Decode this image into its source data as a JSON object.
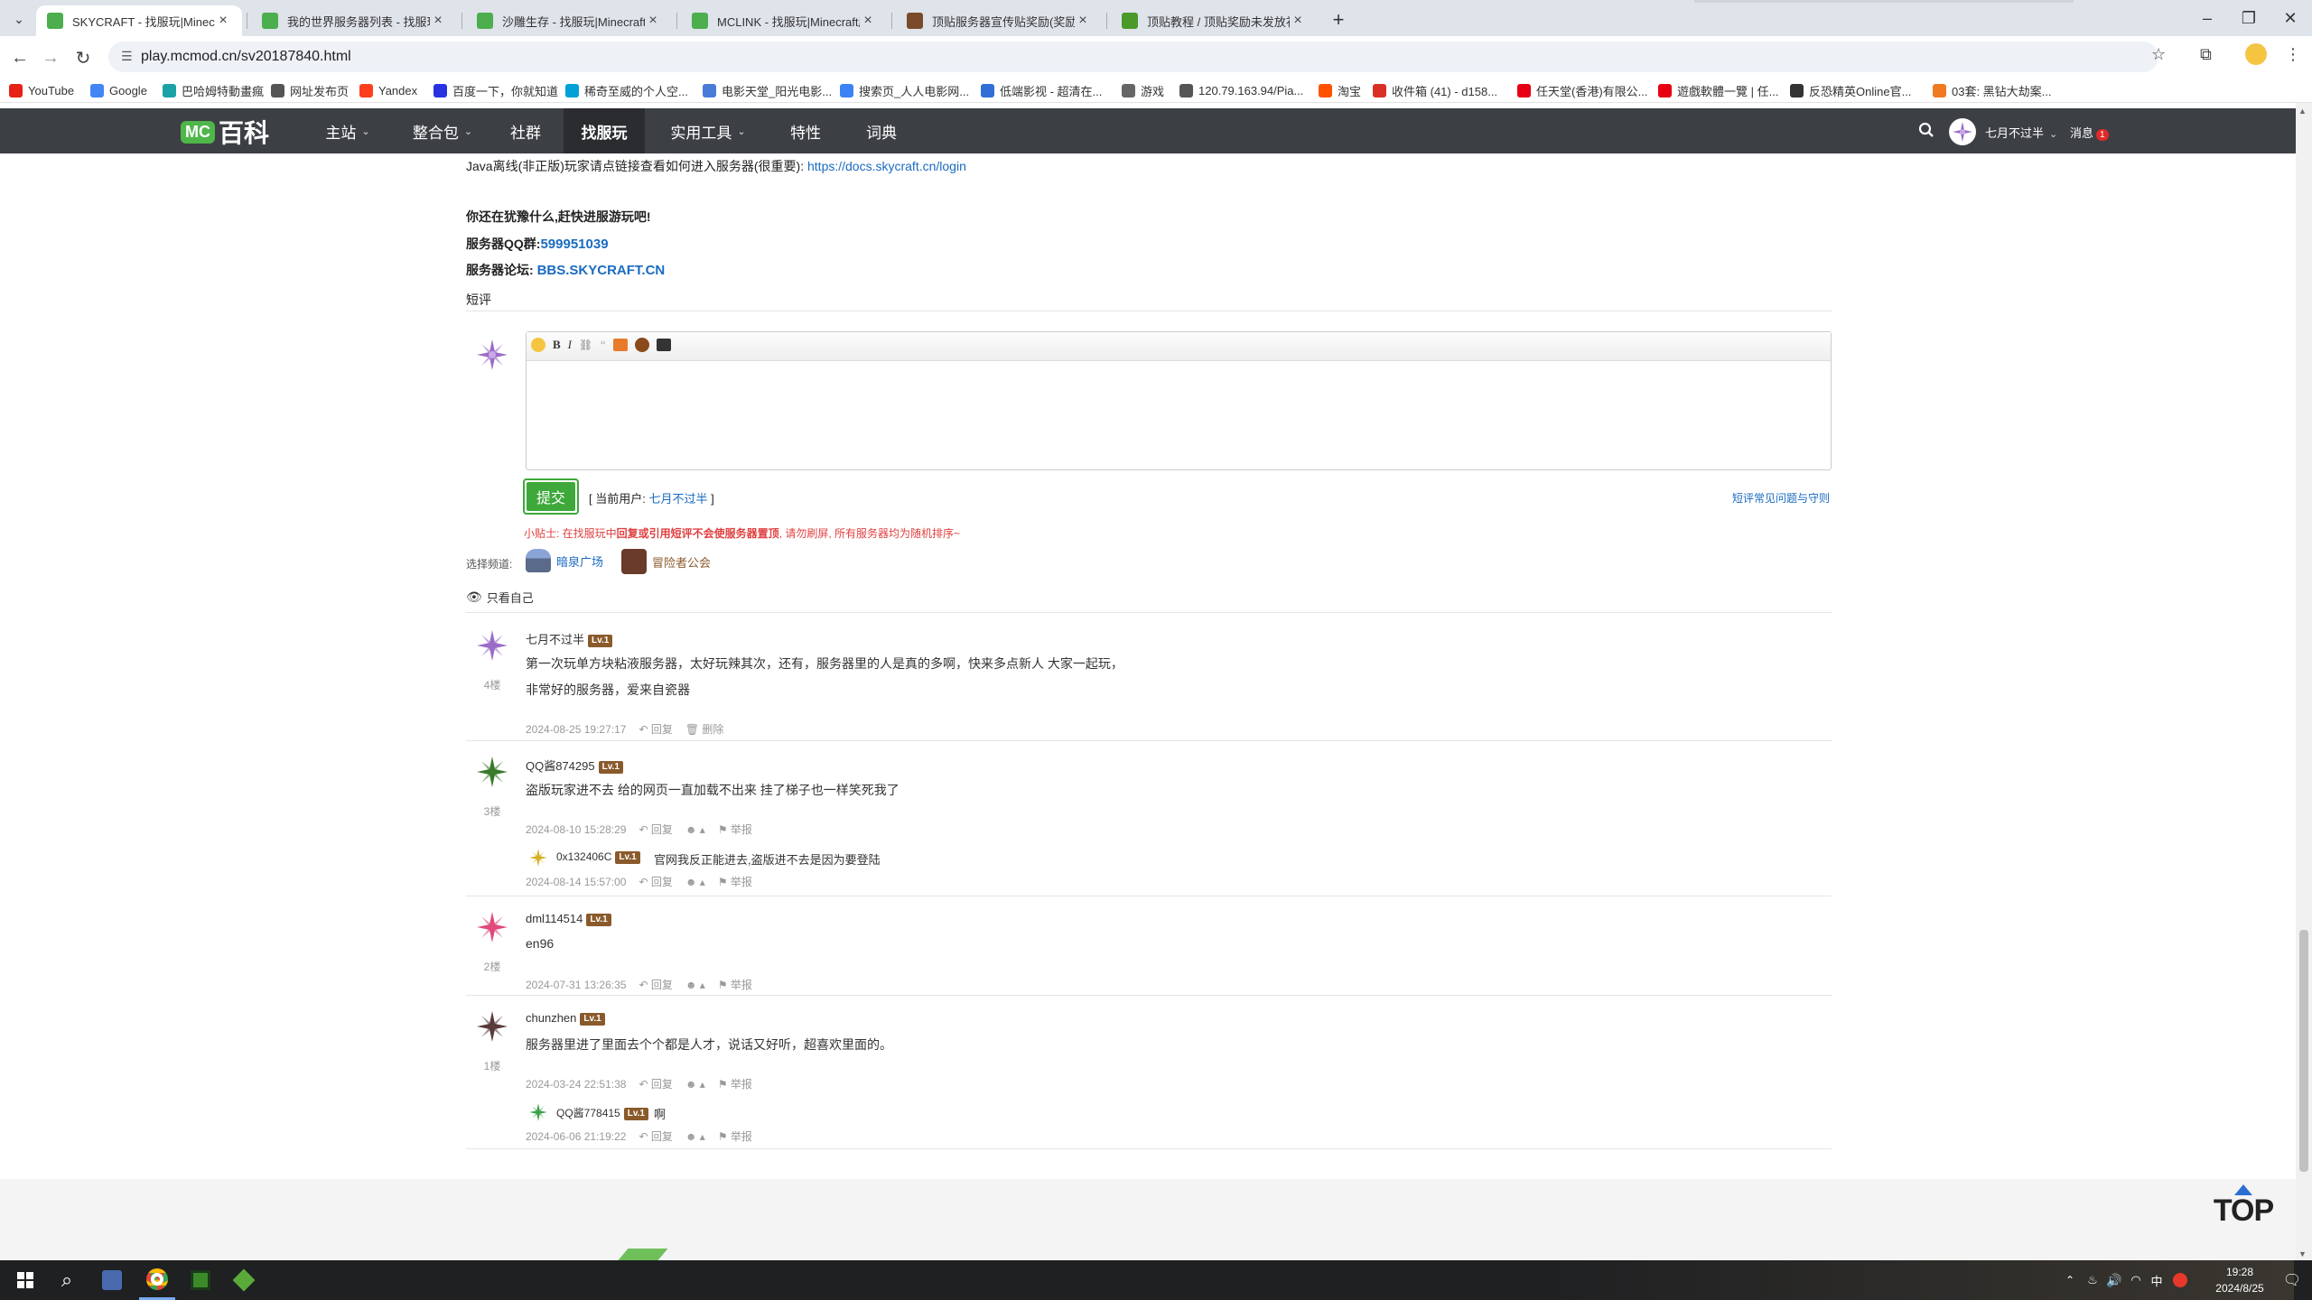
{
  "browser": {
    "tabs": [
      {
        "title": "SKYCRAFT - 找服玩|Minecraft",
        "color": "#4cae4c"
      },
      {
        "title": "我的世界服务器列表 - 找服玩|M",
        "color": "#4cae4c"
      },
      {
        "title": "沙雕生存 - 找服玩|Minecraft服",
        "color": "#4cae4c"
      },
      {
        "title": "MCLINK - 找服玩|Minecraft服",
        "color": "#4cae4c"
      },
      {
        "title": "顶贴服务器宣传贴奖励(奖励天空",
        "color": "#7a4a2a"
      },
      {
        "title": "顶贴教程 / 顶贴奖励未发放补领",
        "color": "#4a9a2a"
      }
    ],
    "new_tab": "+",
    "url": "play.mcmod.cn/sv20187840.html",
    "bookmarks": [
      {
        "label": "YouTube",
        "color": "#e62117"
      },
      {
        "label": "Google",
        "color": "#4285f4"
      },
      {
        "label": "巴哈姆特動畫瘋",
        "color": "#1aa2a6"
      },
      {
        "label": "网址发布页",
        "color": "#555"
      },
      {
        "label": "Yandex",
        "color": "#fc3f1d"
      },
      {
        "label": "百度一下，你就知道",
        "color": "#2932e1"
      },
      {
        "label": "稀奇至威的个人空...",
        "color": "#00a1d6"
      },
      {
        "label": "电影天堂_阳光电影...",
        "color": "#4a7bd8"
      },
      {
        "label": "搜索页_人人电影网...",
        "color": "#3b82f6"
      },
      {
        "label": "低端影视 - 超清在...",
        "color": "#2f6fd6"
      },
      {
        "label": "游戏",
        "color": "#666"
      },
      {
        "label": "120.79.163.94/Pia...",
        "color": "#555"
      },
      {
        "label": "淘宝",
        "color": "#ff5000"
      },
      {
        "label": "收件箱 (41) - d158...",
        "color": "#d93025"
      },
      {
        "label": "任天堂(香港)有限公...",
        "color": "#e60012"
      },
      {
        "label": "遊戲軟體一覽 | 任...",
        "color": "#e60012"
      },
      {
        "label": "反恐精英Online官...",
        "color": "#333"
      },
      {
        "label": "03套: 黑钻大劫案...",
        "color": "#f07a20"
      }
    ]
  },
  "site": {
    "logo_mc": "MC",
    "logo_text": "百科",
    "nav": [
      {
        "label": "主站",
        "caret": true
      },
      {
        "label": "整合包",
        "caret": true
      },
      {
        "label": "社群",
        "caret": false
      },
      {
        "label": "找服玩",
        "caret": false,
        "selected": true
      },
      {
        "label": "实用工具",
        "caret": true
      },
      {
        "label": "特性",
        "caret": false
      },
      {
        "label": "词典",
        "caret": false
      }
    ],
    "user_name": "七月不过半",
    "messages_label": "消息",
    "messages_count": "1"
  },
  "content": {
    "java_note": "Java离线(非正版)玩家请点链接查看如何进入服务器(很重要):",
    "java_link": "https://docs.skycraft.cn/login",
    "hesitate": "你还在犹豫什么,赶快进服游玩吧!",
    "qq_label": "服务器QQ群:",
    "qq_value": "599951039",
    "forum_label": "服务器论坛:",
    "forum_value": "BBS.SKYCRAFT.CN",
    "short_review": "短评",
    "submit": "提交",
    "current_user_prefix": "[ 当前用户:",
    "current_user": "七月不过半",
    "current_user_suffix": "]",
    "faq_link": "短评常见问题与守则",
    "tip_prefix": "小贴士: 在找服玩中",
    "tip_bold": "回复或引用短评不会使服务器置顶",
    "tip_suffix": ", 请勿刷屏, 所有服务器均为随机排序~",
    "channel_label": "选择频道:",
    "channel1": "暗泉广场",
    "channel2": "冒险者公会",
    "only_mine": "只看自己",
    "reply": "回复",
    "delete": "删除",
    "report": "举报",
    "lv": "Lv.1"
  },
  "comments": [
    {
      "floor": "4楼",
      "author": "七月不过半",
      "lines": [
        "第一次玩单方块粘液服务器，太好玩辣其次，还有，服务器里的人是真的多啊，快来多点新人 大家一起玩，",
        "非常好的服务器，爱来自瓷器"
      ],
      "time": "2024-08-25 19:27:17",
      "own": true,
      "avatar_color": "#9b6cc7"
    },
    {
      "floor": "3楼",
      "author": "QQ酱874295",
      "lines": [
        "盗版玩家进不去 给的网页一直加载不出来 挂了梯子也一样笑死我了"
      ],
      "time": "2024-08-10 15:28:29",
      "own": false,
      "avatar_color": "#3a7a2a",
      "reply": {
        "author": "0x132406C",
        "text": "官网我反正能进去,盗版进不去是因为要登陆",
        "time": "2024-08-14 15:57:00",
        "avatar_color": "#d4b020"
      }
    },
    {
      "floor": "2楼",
      "author": "dml114514",
      "lines": [
        "en96"
      ],
      "time": "2024-07-31 13:26:35",
      "own": false,
      "avatar_color": "#e04a7a"
    },
    {
      "floor": "1楼",
      "author": "chunzhen",
      "lines": [
        "服务器里进了里面去个个都是人才，说话又好听，超喜欢里面的。"
      ],
      "time": "2024-03-24 22:51:38",
      "own": false,
      "avatar_color": "#5a3a3a",
      "reply": {
        "author": "QQ酱778415",
        "text": "啊",
        "time": "2024-06-06 21:19:22",
        "avatar_color": "#3aa04a"
      }
    }
  ],
  "top_button": "TOP",
  "taskbar": {
    "time": "19:28",
    "date": "2024/8/25",
    "ime": "中"
  }
}
